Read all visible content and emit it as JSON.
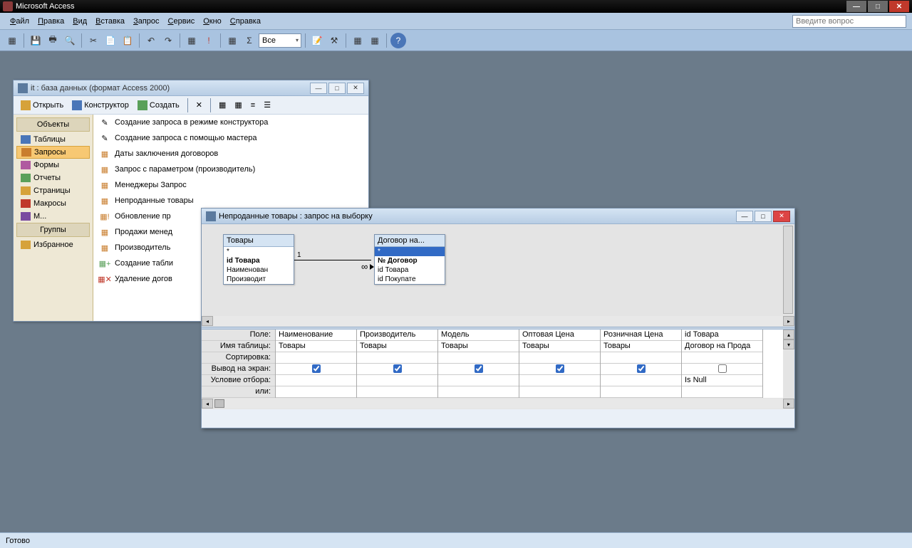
{
  "app": {
    "title": "Microsoft Access"
  },
  "menu": [
    "Файл",
    "Правка",
    "Вид",
    "Вставка",
    "Запрос",
    "Сервис",
    "Окно",
    "Справка"
  ],
  "askbox": {
    "placeholder": "Введите вопрос"
  },
  "toolbar_combo": "Все",
  "dbwin": {
    "title": "it : база данных (формат Access 2000)",
    "toolbar": {
      "open": "Открыть",
      "design": "Конструктор",
      "create": "Создать"
    },
    "groups": {
      "objects": "Объекты",
      "groups": "Группы"
    },
    "sidebar": [
      "Таблицы",
      "Запросы",
      "Формы",
      "Отчеты",
      "Страницы",
      "Макросы",
      "Модули"
    ],
    "sidebar_selected": 1,
    "favorites": "Избранное",
    "items": [
      "Создание запроса в режиме конструктора",
      "Создание запроса с помощью мастера",
      "Даты заключения договоров",
      "Запрос с параметром (производитель)",
      "Менеджеры Запрос",
      "Непроданные товары",
      "Обновление пр",
      "Продажи менед",
      "Производитель",
      "Создание табли",
      "Удаление догов"
    ]
  },
  "qwin": {
    "title": "Непроданные товары : запрос на выборку",
    "table1": {
      "name": "Товары",
      "fields": [
        "*",
        "id Товара",
        "Наименован",
        "Производит"
      ],
      "pk_index": 1
    },
    "table2": {
      "name": "Договор на...",
      "fields": [
        "*",
        "№ Договор",
        "id Товара",
        "id Покупате"
      ],
      "pk_index": 1,
      "selected_index": 0
    },
    "relation": {
      "left": "1",
      "right": "∞"
    },
    "grid_labels": [
      "Поле:",
      "Имя таблицы:",
      "Сортировка:",
      "Вывод на экран:",
      "Условие отбора:",
      "или:"
    ],
    "columns": [
      {
        "field": "Наименование",
        "table": "Товары",
        "show": true,
        "criteria": ""
      },
      {
        "field": "Производитель",
        "table": "Товары",
        "show": true,
        "criteria": ""
      },
      {
        "field": "Модель",
        "table": "Товары",
        "show": true,
        "criteria": ""
      },
      {
        "field": "Оптовая Цена",
        "table": "Товары",
        "show": true,
        "criteria": ""
      },
      {
        "field": "Розничная Цена",
        "table": "Товары",
        "show": true,
        "criteria": ""
      },
      {
        "field": "id Товара",
        "table": "Договор на Прода",
        "show": false,
        "criteria": "Is Null"
      }
    ]
  },
  "status": "Готово",
  "colors": {
    "sidebar_icons": [
      "#4a76b8",
      "#c97e2e",
      "#b05aa0",
      "#5aa05a",
      "#d6a23a",
      "#c0392b",
      "#7a4aa0"
    ]
  }
}
